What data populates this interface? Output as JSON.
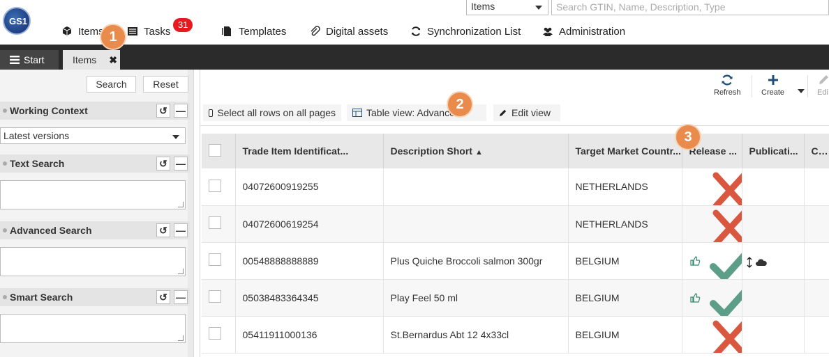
{
  "topbar": {
    "logo_text": "GS1",
    "scope_select": "Items",
    "search_placeholder": "Search GTIN, Name, Description, Type",
    "nav": [
      {
        "label": "Items",
        "icon": "cube-icon"
      },
      {
        "label": "Tasks",
        "icon": "tasks-icon"
      },
      {
        "label": "Templates",
        "icon": "templates-icon"
      },
      {
        "label": "Digital assets",
        "icon": "paperclip-icon"
      },
      {
        "label": "Synchronization List",
        "icon": "sync-icon"
      },
      {
        "label": "Administration",
        "icon": "users-icon"
      }
    ],
    "tasks_badge": "31"
  },
  "tabs": {
    "start_label": "Start",
    "items_label": "Items",
    "close_glyph": "✖"
  },
  "steps": [
    "1",
    "2",
    "3"
  ],
  "left_panel": {
    "search_button": "Search",
    "reset_button": "Reset",
    "sections": [
      {
        "title": "Working Context"
      },
      {
        "title": "Text Search"
      },
      {
        "title": "Advanced Search"
      },
      {
        "title": "Smart Search"
      }
    ],
    "working_context_value": "Latest versions",
    "reset_glyph": "↺",
    "collapse_glyph": "—"
  },
  "toolbar": {
    "refresh_label": "Refresh",
    "create_label": "Create",
    "edit_label": "Edi"
  },
  "viewbar": {
    "select_all": "Select all rows on all pages",
    "table_view": "Table view: Advanced",
    "edit_view": "Edit view"
  },
  "table": {
    "columns": [
      "Trade Item Identificat...",
      "Description Short",
      "Target Market Countr...",
      "Release ...",
      "Publicati...",
      "CIC State..."
    ],
    "sort_glyph": "▲",
    "rows": [
      {
        "gtin": "04072600919255",
        "description": "",
        "market": "NETHERLANDS",
        "status": "cross",
        "thumb": false,
        "pub": false
      },
      {
        "gtin": "04072600619254",
        "description": "",
        "market": "NETHERLANDS",
        "status": "cross",
        "thumb": false,
        "pub": false
      },
      {
        "gtin": "00548888888889",
        "description": "Plus Quiche Broccoli salmon 300gr",
        "market": "BELGIUM",
        "status": "check",
        "thumb": true,
        "pub": true
      },
      {
        "gtin": "05038483364345",
        "description": "Play Feel 50 ml",
        "market": "BELGIUM",
        "status": "check",
        "thumb": true,
        "pub": false
      },
      {
        "gtin": "05411911000136",
        "description": "St.Bernardus Abt 12 4x33cl",
        "market": "BELGIUM",
        "status": "cross",
        "thumb": false,
        "pub": false
      }
    ]
  },
  "colors": {
    "step_badge": "#e98b4d",
    "cross": "#d9573f",
    "check": "#5c9e87",
    "tabbar": "#2b2b2b",
    "tasks_badge": "#e8181e"
  }
}
